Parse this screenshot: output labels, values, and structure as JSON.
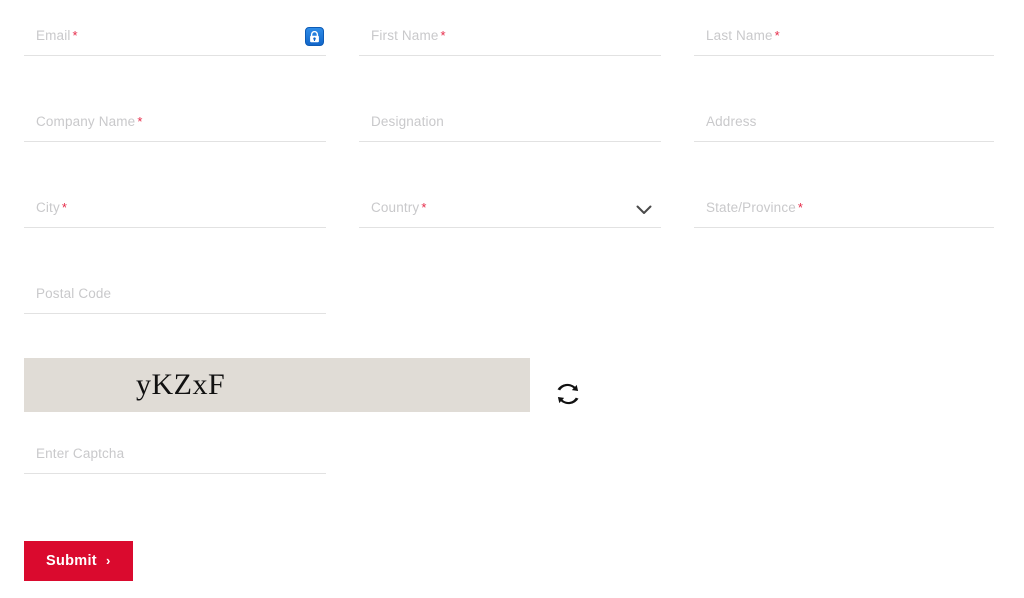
{
  "form": {
    "required_marker": "*",
    "accent_color": "#da0a2e",
    "required_color": "#e62b49",
    "placeholder_color": "#c9c9cb",
    "underline_color": "#e2e2e2",
    "fields": [
      {
        "id": "email",
        "label": "Email",
        "required": true,
        "value": "",
        "type": "text",
        "icon": "lock-badge-icon"
      },
      {
        "id": "first_name",
        "label": "First Name",
        "required": true,
        "value": "",
        "type": "text"
      },
      {
        "id": "last_name",
        "label": "Last Name",
        "required": true,
        "value": "",
        "type": "text"
      },
      {
        "id": "company_name",
        "label": "Company Name",
        "required": true,
        "value": "",
        "type": "text"
      },
      {
        "id": "designation",
        "label": "Designation",
        "required": false,
        "value": "",
        "type": "text"
      },
      {
        "id": "address",
        "label": "Address",
        "required": false,
        "value": "",
        "type": "text"
      },
      {
        "id": "city",
        "label": "City",
        "required": true,
        "value": "",
        "type": "text"
      },
      {
        "id": "country",
        "label": "Country",
        "required": true,
        "value": "",
        "type": "select",
        "icon": "chevron-down-icon"
      },
      {
        "id": "state",
        "label": "State/Province",
        "required": true,
        "value": "",
        "type": "text"
      },
      {
        "id": "postal_code",
        "label": "Postal Code",
        "required": false,
        "value": "",
        "type": "text"
      }
    ]
  },
  "captcha": {
    "code": "yKZxF",
    "background_color": "#e0dcd6",
    "refresh_icon": "refresh-icon",
    "input": {
      "label": "Enter Captcha",
      "required": false,
      "value": ""
    }
  },
  "submit": {
    "label": "Submit",
    "arrow": "›",
    "background_color": "#da0a2e",
    "text_color": "#ffffff"
  }
}
